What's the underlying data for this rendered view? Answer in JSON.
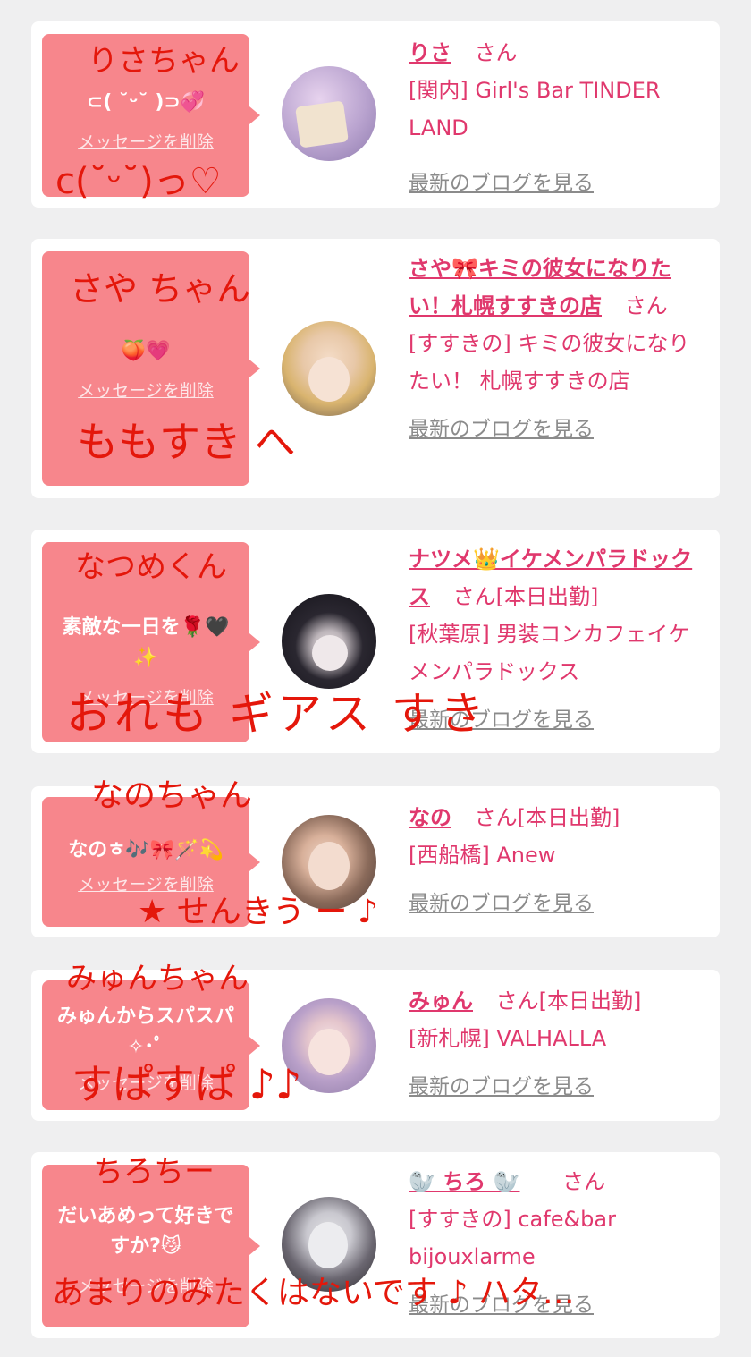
{
  "entries": [
    {
      "message": "⊂( ˘ᵕ˘ )⊃💞",
      "delete_label": "メッセージを削除",
      "name": "りさ",
      "honorific": "さん",
      "status": "",
      "shop": "[関内] Girl's Bar TINDER LAND",
      "blog_label": "最新のブログを見る",
      "handwriting_top": "りさちゃん",
      "handwriting_bottom": "c(˘ᵕ˘)っ♡"
    },
    {
      "message": "🍑💗",
      "delete_label": "メッセージを削除",
      "name": "さや🎀キミの彼女になりたい！札幌すすきの店",
      "honorific": "さん",
      "status": "",
      "shop": "[すすきの] キミの彼女になりたい！ 札幌すすきの店",
      "blog_label": "最新のブログを見る",
      "handwriting_top": "さや ちゃん",
      "handwriting_bottom": "ももすき へ"
    },
    {
      "message": "素敵な一日を🌹🖤 ✨",
      "delete_label": "メッセージを削除",
      "name": "ナツメ👑イケメンパラドックス",
      "honorific": "さん",
      "status": "[本日出勤]",
      "shop": "[秋葉原] 男装コンカフェイケメンパラドックス",
      "blog_label": "最新のブログを見る",
      "handwriting_top": "なつめくん",
      "handwriting_bottom": "おれも ギアス すき"
    },
    {
      "message": "なのㅎ🎶🎀🪄💫",
      "delete_label": "メッセージを削除",
      "name": "なの",
      "honorific": "さん",
      "status": "[本日出勤]",
      "shop": "[西船橋] Anew",
      "blog_label": "最新のブログを見る",
      "handwriting_top": "なのちゃん",
      "handwriting_bottom": "★ せんきう ー ♪"
    },
    {
      "message": "みゅんからスパスパ✧･ﾟ",
      "delete_label": "メッセージを削除",
      "name": "みゅん",
      "honorific": "さん",
      "status": "[本日出勤]",
      "shop": "[新札幌] VALHALLA",
      "blog_label": "最新のブログを見る",
      "handwriting_top": "みゅんちゃん",
      "handwriting_bottom": "すぱすぱ ♪♪"
    },
    {
      "message": "だいあめって好きですか?😼",
      "delete_label": "メッセージを削除",
      "name": "🦭 ちろ 🦭",
      "honorific": "さん",
      "status": "",
      "shop": "[すすきの] cafe&bar bijouxlarme",
      "blog_label": "最新のブログを見る",
      "handwriting_top": "ちろちー",
      "handwriting_bottom": "あまりのみたくはないです ♪ ハタ…"
    }
  ],
  "colors": {
    "bubble": "#f7868c",
    "accent": "#e0386d",
    "link_gray": "#8b8b8b",
    "handwriting": "#e4170b",
    "background": "#efeff0"
  }
}
